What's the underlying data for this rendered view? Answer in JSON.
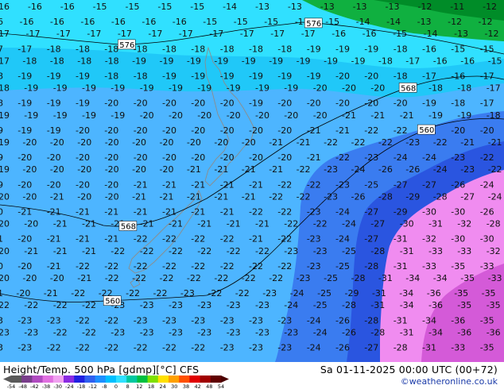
{
  "footer": {
    "title": "Height/Temp. 500 hPa [gdmp][°C] CFS",
    "valid": "Sa 01-11-2025 00:00 UTC (00+72)",
    "credit": "©weatheronline.co.uk"
  },
  "legend": {
    "ticks": [
      "-54",
      "-48",
      "-42",
      "-38",
      "-30",
      "-24",
      "-18",
      "-12",
      "-8",
      "0",
      "8",
      "12",
      "18",
      "24",
      "30",
      "38",
      "42",
      "48",
      "54"
    ],
    "colors": [
      "#5a5a5a",
      "#7a3e8c",
      "#b04bc0",
      "#e070e0",
      "#f0a0f0",
      "#8a2be2",
      "#2020e0",
      "#3060f0",
      "#1e90ff",
      "#00c0ff",
      "#30e0ff",
      "#00c8a0",
      "#00c040",
      "#80e000",
      "#ffe000",
      "#ffa000",
      "#ff5000",
      "#e00000",
      "#a00000",
      "#600000"
    ],
    "arrow_color": "#4a0000"
  },
  "colors": {
    "green_dark": "#008c28",
    "green_mid": "#10b040",
    "cyan_light": "#30e0ff",
    "cyan_mid": "#20c8f8",
    "blue_light": "#4db5ff",
    "blue_mid": "#3a7cf0",
    "blue_deep": "#2a55e0",
    "pink": "#f08cf0",
    "violet": "#d45ad8",
    "coast": "#8c8c8c"
  },
  "contours": [
    "576",
    "568",
    "560"
  ],
  "contour_labels": [
    "576",
    "576",
    "568",
    "568",
    "560",
    "560"
  ],
  "temp_rows": [
    [
      "-16",
      "-16",
      "-16",
      "-15",
      "-15",
      "-15",
      "-15",
      "-14",
      "-13",
      "-13",
      "-13",
      "-13",
      "-13",
      "-12",
      "-11",
      "-12"
    ],
    [
      "-16",
      "-16",
      "-16",
      "-16",
      "-16",
      "-16",
      "-16",
      "-15",
      "-15",
      "-15",
      "-15",
      "-15",
      "-14",
      "-14",
      "-13",
      "-12",
      "-12"
    ],
    [
      "-17",
      "-17",
      "-17",
      "-17",
      "-17",
      "-17",
      "-17",
      "-17",
      "-17",
      "-17",
      "-17",
      "-16",
      "-16",
      "-15",
      "-14",
      "-13",
      "-12"
    ],
    [
      "-17",
      "-17",
      "-18",
      "-18",
      "-18",
      "-18",
      "-18",
      "-18",
      "-18",
      "-18",
      "-18",
      "-19",
      "-19",
      "-19",
      "-18",
      "-16",
      "-15",
      "-15"
    ],
    [
      "-17",
      "-18",
      "-18",
      "-18",
      "-18",
      "-19",
      "-19",
      "-19",
      "-19",
      "-19",
      "-19",
      "-19",
      "-19",
      "-19",
      "-18",
      "-17",
      "-16",
      "-16",
      "-15"
    ],
    [
      "-18",
      "-19",
      "-19",
      "-19",
      "-18",
      "-18",
      "-19",
      "-19",
      "-19",
      "-19",
      "-19",
      "-19",
      "-20",
      "-20",
      "-18",
      "-17",
      "-16",
      "-17"
    ],
    [
      "-18",
      "-19",
      "-19",
      "-19",
      "-19",
      "-19",
      "-19",
      "-19",
      "-19",
      "-19",
      "-19",
      "-20",
      "-20",
      "-20",
      "-19",
      "-18",
      "-18",
      "-17"
    ],
    [
      "-18",
      "-19",
      "-19",
      "-19",
      "-20",
      "-20",
      "-20",
      "-20",
      "-20",
      "-19",
      "-20",
      "-20",
      "-20",
      "-20",
      "-20",
      "-19",
      "-18",
      "-17"
    ],
    [
      "-19",
      "-19",
      "-19",
      "-19",
      "-19",
      "-20",
      "-20",
      "-20",
      "-20",
      "-20",
      "-20",
      "-20",
      "-21",
      "-21",
      "-21",
      "-19",
      "-19",
      "-18"
    ],
    [
      "-19",
      "-19",
      "-19",
      "-20",
      "-20",
      "-20",
      "-20",
      "-20",
      "-20",
      "-20",
      "-20",
      "-21",
      "-21",
      "-22",
      "-22",
      "-21",
      "-20",
      "-20"
    ],
    [
      "-19",
      "-20",
      "-20",
      "-20",
      "-20",
      "-20",
      "-20",
      "-20",
      "-20",
      "-20",
      "-21",
      "-21",
      "-22",
      "-22",
      "-22",
      "-23",
      "-22",
      "-21",
      "-21"
    ],
    [
      "-19",
      "-20",
      "-20",
      "-20",
      "-20",
      "-20",
      "-20",
      "-20",
      "-20",
      "-20",
      "-20",
      "-21",
      "-22",
      "-23",
      "-24",
      "-24",
      "-23",
      "-22"
    ],
    [
      "-19",
      "-20",
      "-20",
      "-20",
      "-20",
      "-20",
      "-20",
      "-21",
      "-21",
      "-21",
      "-21",
      "-22",
      "-23",
      "-24",
      "-26",
      "-26",
      "-24",
      "-23",
      "-22"
    ],
    [
      "-19",
      "-20",
      "-20",
      "-20",
      "-20",
      "-21",
      "-21",
      "-21",
      "-21",
      "-21",
      "-22",
      "-22",
      "-23",
      "-25",
      "-27",
      "-27",
      "-26",
      "-24"
    ],
    [
      "-20",
      "-20",
      "-21",
      "-20",
      "-20",
      "-21",
      "-21",
      "-21",
      "-21",
      "-21",
      "-22",
      "-22",
      "-23",
      "-26",
      "-28",
      "-29",
      "-28",
      "-27",
      "-24"
    ],
    [
      "-20",
      "-21",
      "-21",
      "-21",
      "-21",
      "-21",
      "-21",
      "-21",
      "-21",
      "-22",
      "-22",
      "-23",
      "-24",
      "-27",
      "-29",
      "-30",
      "-30",
      "-26"
    ],
    [
      "-20",
      "-20",
      "-21",
      "-21",
      "-21",
      "-21",
      "-21",
      "-21",
      "-21",
      "-21",
      "-22",
      "-22",
      "-24",
      "-27",
      "-30",
      "-31",
      "-32",
      "-28"
    ],
    [
      "-21",
      "-20",
      "-21",
      "-21",
      "-21",
      "-22",
      "-22",
      "-22",
      "-22",
      "-21",
      "-22",
      "-23",
      "-24",
      "-27",
      "-31",
      "-32",
      "-30",
      "-30"
    ],
    [
      "-20",
      "-21",
      "-21",
      "-21",
      "-22",
      "-22",
      "-22",
      "-22",
      "-22",
      "-22",
      "-23",
      "-23",
      "-25",
      "-28",
      "-31",
      "-33",
      "-33",
      "-32"
    ],
    [
      "-20",
      "-20",
      "-21",
      "-22",
      "-22",
      "-22",
      "-22",
      "-22",
      "-22",
      "-22",
      "-22",
      "-23",
      "-25",
      "-28",
      "-31",
      "-33",
      "-35",
      "-33"
    ],
    [
      "-20",
      "-20",
      "-20",
      "-21",
      "-22",
      "-22",
      "-22",
      "-22",
      "-22",
      "-22",
      "-22",
      "-23",
      "-25",
      "-28",
      "-31",
      "-34",
      "-34",
      "-35",
      "-33"
    ],
    [
      "-21",
      "-20",
      "-21",
      "-22",
      "-22",
      "-22",
      "-22",
      "-23",
      "-22",
      "-22",
      "-23",
      "-24",
      "-25",
      "-29",
      "-31",
      "-34",
      "-36",
      "-35",
      "-35"
    ],
    [
      "-22",
      "-22",
      "-22",
      "-22",
      "-23",
      "-23",
      "-23",
      "-23",
      "-23",
      "-23",
      "-24",
      "-25",
      "-28",
      "-31",
      "-34",
      "-36",
      "-35",
      "-35"
    ],
    [
      "-23",
      "-23",
      "-23",
      "-22",
      "-22",
      "-23",
      "-23",
      "-23",
      "-23",
      "-23",
      "-23",
      "-24",
      "-26",
      "-28",
      "-31",
      "-34",
      "-36",
      "-35"
    ],
    [
      "-23",
      "-23",
      "-22",
      "-22",
      "-23",
      "-23",
      "-23",
      "-23",
      "-23",
      "-23",
      "-23",
      "-24",
      "-26",
      "-28",
      "-31",
      "-34",
      "-36",
      "-36"
    ],
    [
      "-23",
      "-23",
      "-22",
      "-22",
      "-22",
      "-22",
      "-22",
      "-22",
      "-23",
      "-23",
      "-23",
      "-24",
      "-26",
      "-27",
      "-28",
      "-31",
      "-33",
      "-35"
    ]
  ]
}
